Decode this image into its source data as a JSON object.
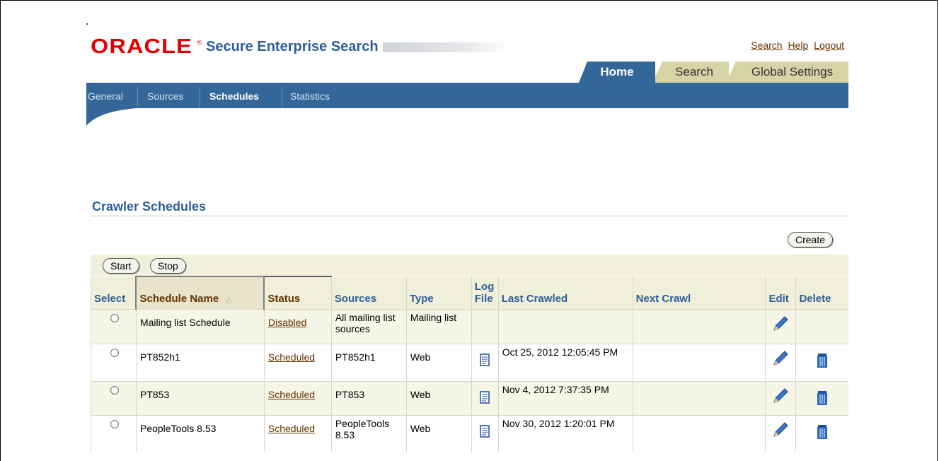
{
  "branding": {
    "oracle": "ORACLE",
    "product": "Secure Enterprise Search"
  },
  "global_links": [
    "Search",
    "Help",
    "Logout"
  ],
  "tabs": [
    {
      "label": "Home",
      "active": true
    },
    {
      "label": "Search",
      "active": false
    },
    {
      "label": "Global Settings",
      "active": false
    }
  ],
  "subnav": [
    {
      "label": "General",
      "active": false
    },
    {
      "label": "Sources",
      "active": false
    },
    {
      "label": "Schedules",
      "active": true
    },
    {
      "label": "Statistics",
      "active": false
    }
  ],
  "section_title": "Crawler Schedules",
  "buttons": {
    "create": "Create",
    "start": "Start",
    "stop": "Stop"
  },
  "table": {
    "headers": {
      "select": "Select",
      "schedule_name": "Schedule Name",
      "status": "Status",
      "sources": "Sources",
      "type": "Type",
      "log_file_1": "Log",
      "log_file_2": "File",
      "last_crawled": "Last Crawled",
      "next_crawl": "Next Crawl",
      "edit": "Edit",
      "delete": "Delete"
    },
    "rows": [
      {
        "name": "Mailing list Schedule",
        "status": "Disabled",
        "sources": "All mailing list sources",
        "type": "Mailing list",
        "has_log": false,
        "last_crawled": "",
        "next_crawl": "",
        "deletable": false
      },
      {
        "name": "PT852h1",
        "status": "Scheduled",
        "sources": "PT852h1",
        "type": "Web",
        "has_log": true,
        "last_crawled": "Oct 25, 2012 12:05:45 PM",
        "next_crawl": "",
        "deletable": true
      },
      {
        "name": "PT853",
        "status": "Scheduled",
        "sources": "PT853",
        "type": "Web",
        "has_log": true,
        "last_crawled": "Nov 4, 2012 7:37:35 PM",
        "next_crawl": "",
        "deletable": true
      },
      {
        "name": "PeopleTools 8.53",
        "status": "Scheduled",
        "sources": "PeopleTools 8.53",
        "type": "Web",
        "has_log": true,
        "last_crawled": "Nov 30, 2012 1:20:01 PM",
        "next_crawl": "",
        "deletable": true
      }
    ]
  },
  "colors": {
    "brand_red": "#e00000",
    "brand_blue": "#336699",
    "tab_tan": "#d6d3a6",
    "link_brown": "#663300"
  }
}
